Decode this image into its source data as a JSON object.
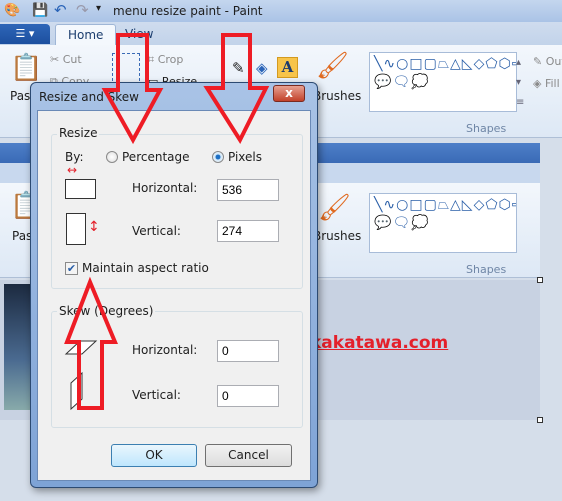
{
  "window": {
    "title": "menu resize paint - Paint"
  },
  "tabs": [
    {
      "label": "Home",
      "active": true
    },
    {
      "label": "View",
      "active": false
    }
  ],
  "ribbon": {
    "paste": "Paste",
    "cut": "Cut",
    "copy": "Copy",
    "crop": "Crop",
    "resize": "Resize",
    "brushes": "Brushes",
    "shapes_label": "Shapes",
    "outline": "Outline",
    "fill": "Fill",
    "shapes_glyphs": "╲∿○□▢⏢△◺◇⬠⬡⇨⇦⇧⇩✧☆✡💬🗨💭"
  },
  "canvas": {
    "text": "kakatawa.com",
    "text_color": "#e4202a"
  },
  "dialog": {
    "title": "Resize and Skew",
    "close": "x",
    "resize": {
      "legend": "Resize",
      "by_label": "By:",
      "percentage_label": "Percentage",
      "pixels_label": "Pixels",
      "selected": "Pixels",
      "horizontal_label": "Horizontal:",
      "horizontal_value": "536",
      "vertical_label": "Vertical:",
      "vertical_value": "274",
      "maintain_label": "Maintain aspect ratio",
      "maintain_checked": true
    },
    "skew": {
      "legend": "Skew (Degrees)",
      "horizontal_label": "Horizontal:",
      "horizontal_value": "0",
      "vertical_label": "Vertical:",
      "vertical_value": "0"
    },
    "ok": "OK",
    "cancel": "Cancel"
  },
  "annotation_color": "#ee1c25"
}
